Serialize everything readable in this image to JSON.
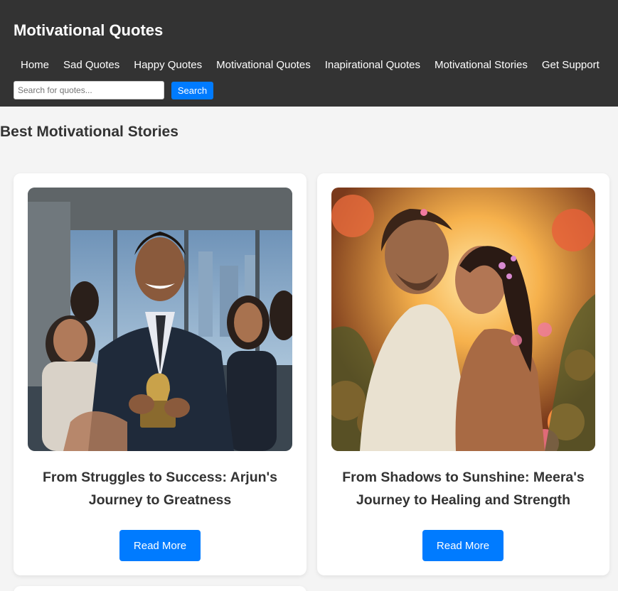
{
  "header": {
    "title": "Motivational Quotes",
    "nav": [
      "Home",
      "Sad Quotes",
      "Happy Quotes",
      "Motivational Quotes",
      "Inapirational Quotes",
      "Motivational Stories",
      "Get Support"
    ],
    "search": {
      "placeholder": "Search for quotes...",
      "value": "",
      "button_label": "Search"
    }
  },
  "main": {
    "section_title": "Best Motivational Stories",
    "stories": [
      {
        "title": "From Struggles to Success: Arjun's Journey to Greatness",
        "image": "man-with-trophy-office-image",
        "button_label": "Read More"
      },
      {
        "title": "From Shadows to Sunshine: Meera's Journey to Healing and Strength",
        "image": "couple-in-flowers-sunset-image",
        "button_label": "Read More"
      }
    ]
  },
  "colors": {
    "header_bg": "#333333",
    "page_bg": "#f4f4f4",
    "accent": "#007bff",
    "card_bg": "#ffffff"
  }
}
